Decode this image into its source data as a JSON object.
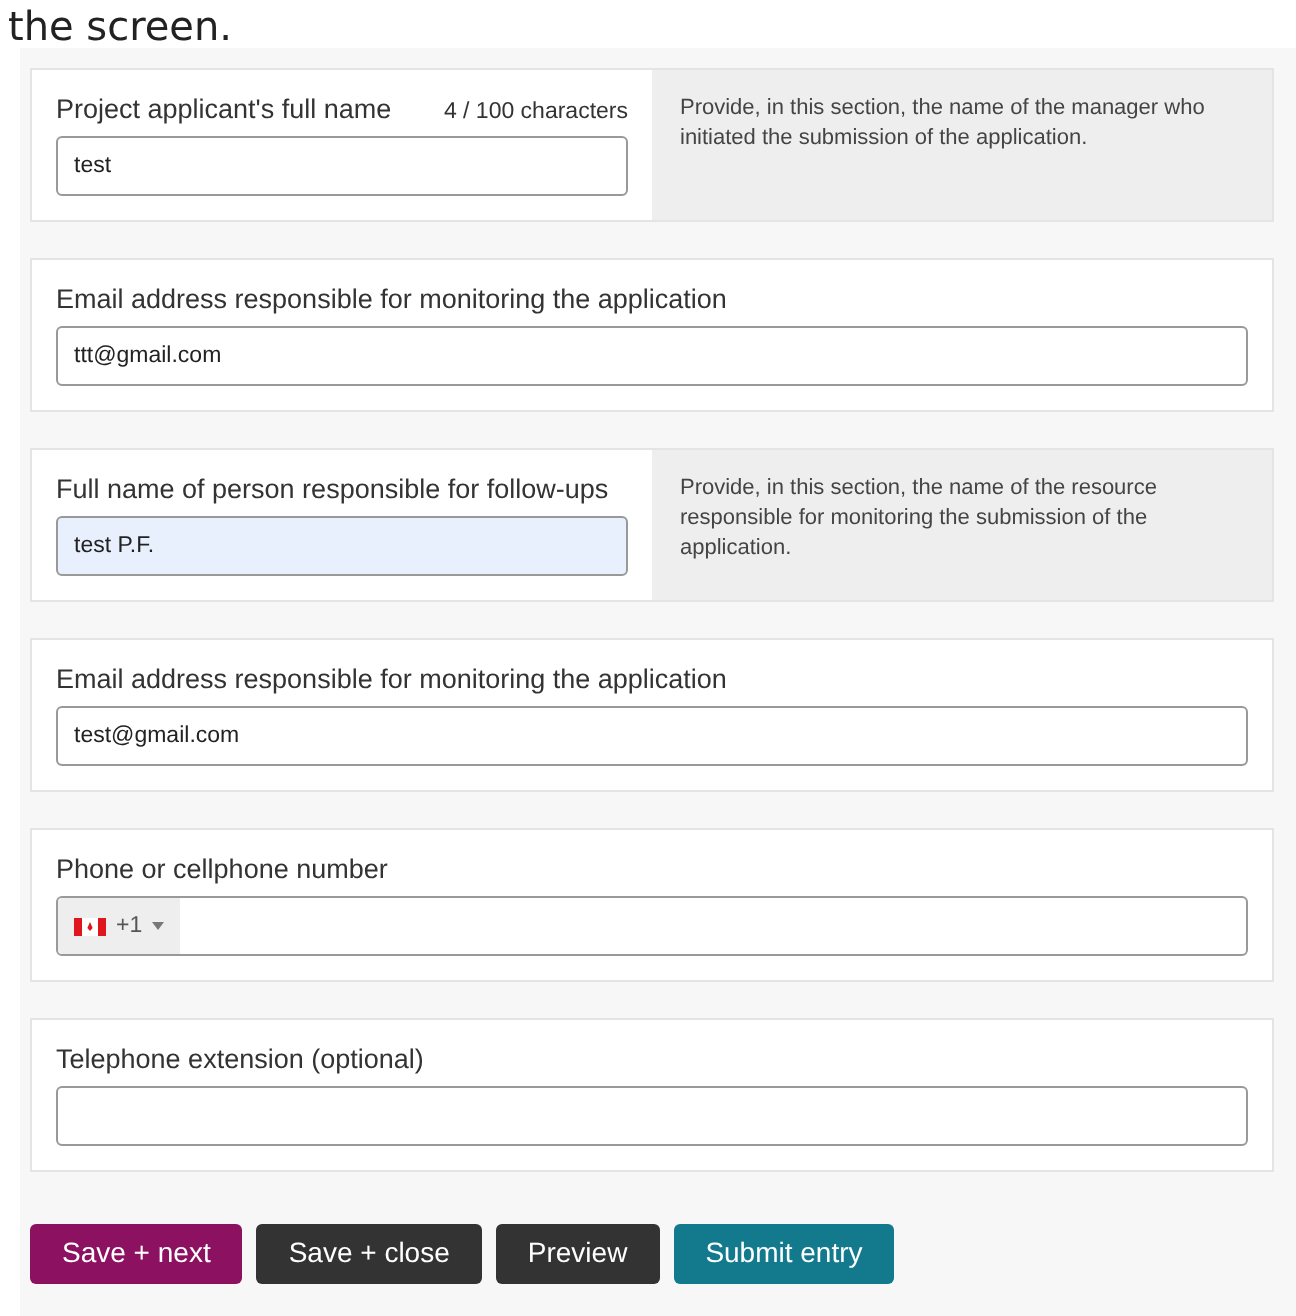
{
  "heading": "the screen.",
  "fields": [
    {
      "kind": "text",
      "label": "Project applicant's full name",
      "counter": "4 / 100 characters",
      "value": "test",
      "autofilled": false,
      "help": "Provide, in this section, the name of the manager who initiated the submission of the application."
    },
    {
      "kind": "text",
      "label": "Email address responsible for monitoring the application",
      "value": "ttt@gmail.com",
      "autofilled": false
    },
    {
      "kind": "text",
      "label": "Full name of person responsible for follow-ups",
      "value": "test P.F.",
      "autofilled": true,
      "help": "Provide, in this section, the name of the resource responsible for monitoring the submission of the application."
    },
    {
      "kind": "text",
      "label": "Email address responsible for monitoring the application",
      "value": "test@gmail.com",
      "autofilled": false
    },
    {
      "kind": "phone",
      "label": "Phone or cellphone number",
      "dial_code": "+1"
    },
    {
      "kind": "text",
      "label": "Telephone extension (optional)",
      "autofilled": false
    }
  ],
  "buttons": [
    {
      "label": "Save + next",
      "color": "#8c1160"
    },
    {
      "label": "Save + close",
      "color": "#333333"
    },
    {
      "label": "Preview",
      "color": "#333333"
    },
    {
      "label": "Submit entry",
      "color": "#137a8e"
    }
  ]
}
